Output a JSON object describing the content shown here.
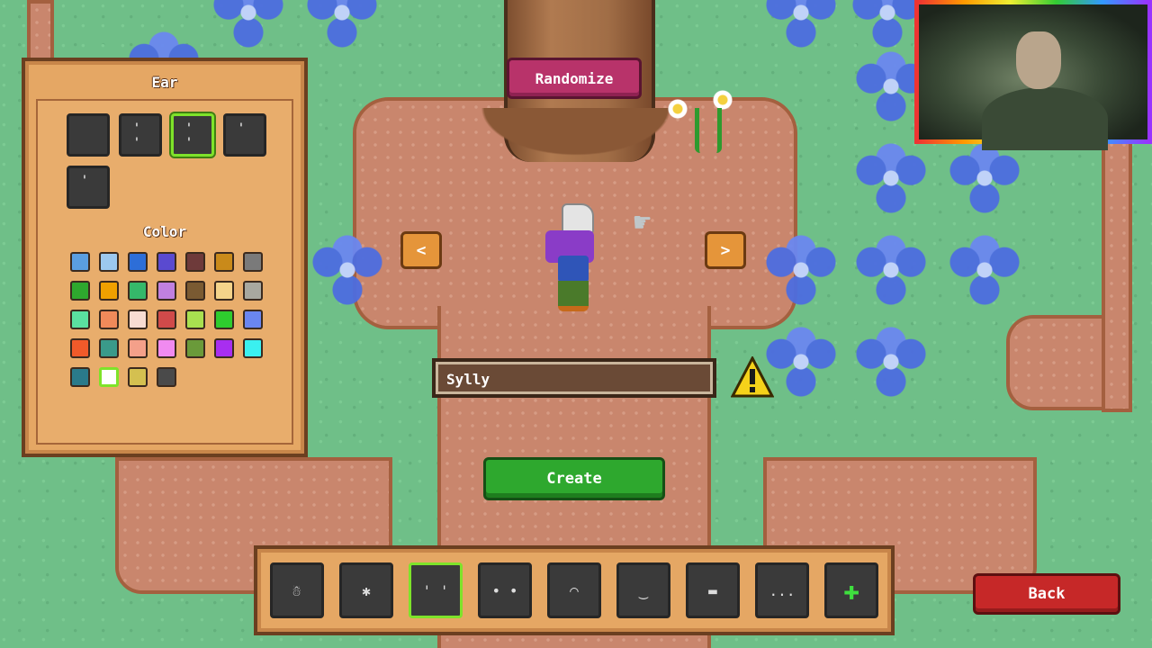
{
  "ear_panel": {
    "title": "Ear",
    "ear_options": [
      {
        "dots": ""
      },
      {
        "dots": "' '"
      },
      {
        "dots": "' '"
      },
      {
        "dots": "'"
      },
      {
        "dots": "'"
      }
    ],
    "selected_ear_index": 2,
    "color_title": "Color",
    "colors": [
      "#5a9ee0",
      "#9cc8ef",
      "#2d6ed8",
      "#5a4ad0",
      "#6e3a3a",
      "#c98a1a",
      "#7a7a7a",
      "#2ea82e",
      "#f0a000",
      "#35b86a",
      "#c080e0",
      "#7a5a32",
      "#f4d38a",
      "#a8a8a0",
      "#5ae0a0",
      "#f08a5a",
      "#f8dcd2",
      "#d04a4a",
      "#a8e050",
      "#2ecc2e",
      "#6a86f0",
      "#f05a2a",
      "#3a9a8a",
      "#f4a08a",
      "#f08af0",
      "#6a9a3a",
      "#a82ef0",
      "#3af0f0",
      "#2a7a8a",
      "#ffffff",
      "#d4c050",
      "#4a4a4a"
    ],
    "selected_color_index": 29
  },
  "actions": {
    "randomize_label": "Randomize",
    "create_label": "Create",
    "back_label": "Back",
    "prev_label": "<",
    "next_label": ">"
  },
  "name_input": {
    "value": "Sylly"
  },
  "hotbar": {
    "slots": [
      {
        "icon": "body-icon",
        "glyph": "☃"
      },
      {
        "icon": "hair-icon",
        "glyph": "✱"
      },
      {
        "icon": "ears-icon",
        "glyph": "' '"
      },
      {
        "icon": "eyes-icon",
        "glyph": "• •"
      },
      {
        "icon": "nose-icon",
        "glyph": "◠"
      },
      {
        "icon": "mouth-icon",
        "glyph": "‿"
      },
      {
        "icon": "beard-icon",
        "glyph": "▬"
      },
      {
        "icon": "detail-icon",
        "glyph": "..."
      },
      {
        "icon": "move-icon",
        "glyph": "✚"
      }
    ],
    "selected_index": 2
  }
}
